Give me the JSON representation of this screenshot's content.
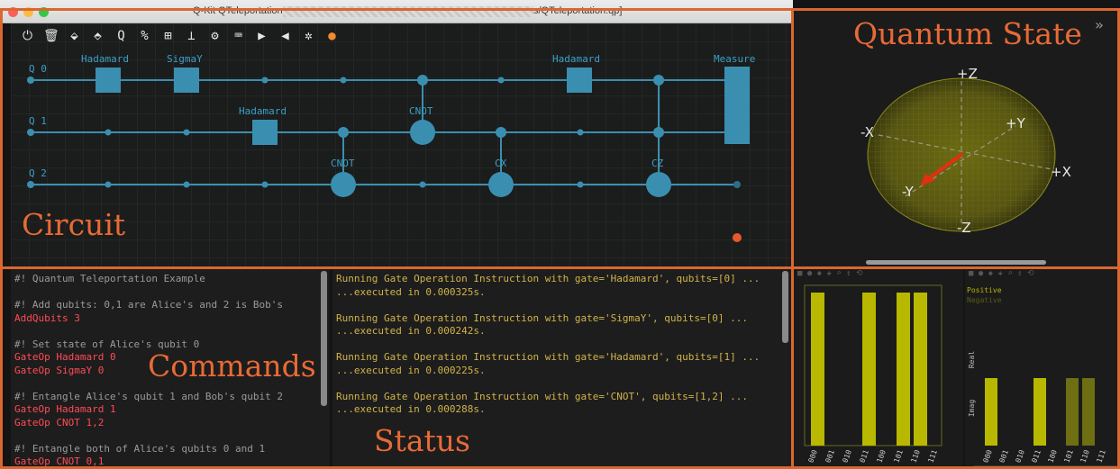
{
  "window": {
    "title": "Q-Kit QTeleportation - ",
    "title_path": "s/QTeleportation.qp]"
  },
  "toolbar": {
    "icons": [
      "power-icon",
      "trash-icon",
      "save-icon",
      "folder-icon",
      "qubit-icon",
      "percent-icon",
      "plus-box-icon",
      "gate-icon",
      "settings-cog-icon",
      "terminal-icon",
      "play-icon",
      "back-icon",
      "gear-icon",
      "debug-icon"
    ]
  },
  "circuit": {
    "label": "Circuit",
    "qubits": [
      "Q 0",
      "Q 1",
      "Q 2"
    ],
    "gates": {
      "g1": "Hadamard",
      "g2": "SigmaY",
      "g3": "Hadamard",
      "g4": "CNOT",
      "g5": "CNOT",
      "g6": "CX",
      "g7": "CZ",
      "g8": "Hadamard",
      "g9": "Measure"
    }
  },
  "quantum_state": {
    "label": "Quantum State",
    "axes": {
      "pz": "+Z",
      "nz": "-Z",
      "px": "+X",
      "nx": "-X",
      "py": "+Y",
      "ny": "-Y"
    }
  },
  "commands": {
    "label": "Commands",
    "lines": [
      {
        "text": "#! Quantum Teleportation Example",
        "kind": "comment"
      },
      {
        "text": "",
        "kind": "comment"
      },
      {
        "text": "#! Add qubits: 0,1 are Alice's and 2 is Bob's",
        "kind": "comment"
      },
      {
        "text": "AddQubits 3",
        "kind": "cmd"
      },
      {
        "text": "",
        "kind": "comment"
      },
      {
        "text": "#! Set state of Alice's qubit 0",
        "kind": "comment"
      },
      {
        "text": "GateOp Hadamard 0",
        "kind": "cmd"
      },
      {
        "text": "GateOp SigmaY 0",
        "kind": "cmd"
      },
      {
        "text": "",
        "kind": "comment"
      },
      {
        "text": "#! Entangle Alice's qubit 1 and Bob's qubit 2",
        "kind": "comment"
      },
      {
        "text": "GateOp Hadamard 1",
        "kind": "cmd"
      },
      {
        "text": "GateOp CNOT 1,2",
        "kind": "cmd"
      },
      {
        "text": "",
        "kind": "comment"
      },
      {
        "text": "#! Entangle both of Alice's qubits 0 and 1",
        "kind": "comment"
      },
      {
        "text": "GateOp CNOT 0,1",
        "kind": "cmd"
      }
    ]
  },
  "status": {
    "label": "Status",
    "lines": [
      "Running Gate Operation Instruction with gate='Hadamard', qubits=[0] ...",
      "...executed in 0.000325s.",
      "",
      "Running Gate Operation Instruction with gate='SigmaY', qubits=[0] ...",
      "...executed in 0.000242s.",
      "",
      "Running Gate Operation Instruction with gate='Hadamard', qubits=[1] ...",
      "...executed in 0.000225s.",
      "",
      "Running Gate Operation Instruction with gate='CNOT', qubits=[1,2] ...",
      "...executed in 0.000288s."
    ]
  },
  "prob_chart": {
    "labels": [
      "000",
      "001",
      "010",
      "011",
      "100",
      "101",
      "110",
      "111"
    ],
    "values": [
      1,
      0,
      0,
      1,
      0,
      1,
      1,
      0
    ],
    "color": "#b8b800"
  },
  "amp_chart": {
    "legend_pos": "Positive",
    "legend_neg": "Negative",
    "ylabel_real": "Real",
    "ylabel_imag": "Imag",
    "labels": [
      "000",
      "001",
      "010",
      "011",
      "100",
      "101",
      "110",
      "111"
    ],
    "values": [
      1,
      0,
      0,
      1,
      0,
      1,
      1,
      0
    ],
    "shade": [
      "bright",
      "none",
      "none",
      "bright",
      "none",
      "dim",
      "dim",
      "none"
    ]
  }
}
